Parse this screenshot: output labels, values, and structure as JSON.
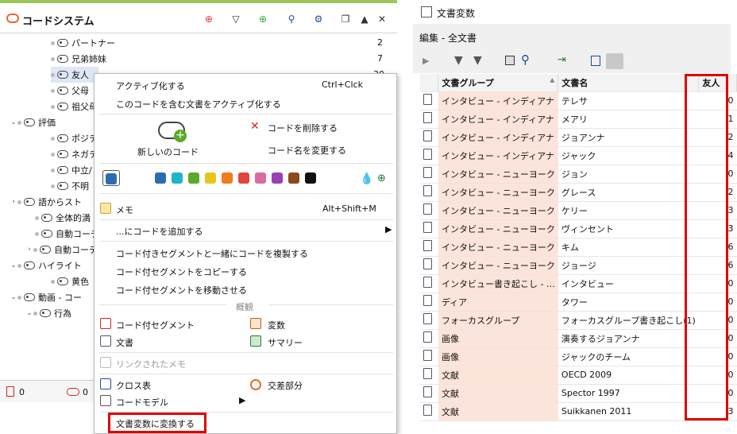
{
  "colors": {
    "accent": "#9bc65a",
    "highlight": "#e00000",
    "groupcell": "#fde4da"
  },
  "left": {
    "title": "コードシステム",
    "header_icons": [
      "code-system-icon",
      "filter-icon",
      "new-code-icon",
      "search-icon",
      "gear-icon",
      "undock-icon",
      "collapse-icon",
      "close-icon"
    ],
    "tree": [
      {
        "label": "パートナー",
        "count": "2"
      },
      {
        "label": "兄弟姉妹",
        "count": "7"
      },
      {
        "label": "友人",
        "count": "30"
      },
      {
        "label": "父母",
        "count": ""
      },
      {
        "label": "祖父母",
        "count": ""
      },
      {
        "label": "評価",
        "count": ""
      },
      {
        "label": "ポジテ",
        "count": ""
      },
      {
        "label": "ネガテ",
        "count": ""
      },
      {
        "label": "中立/",
        "count": ""
      },
      {
        "label": "不明",
        "count": ""
      },
      {
        "label": "語からスト",
        "count": ""
      },
      {
        "label": "全体的満",
        "count": ""
      },
      {
        "label": "自動コーデ",
        "count": ""
      },
      {
        "label": "自動コーデ",
        "count": ""
      },
      {
        "label": "ハイライト",
        "count": ""
      },
      {
        "label": "黄色",
        "count": ""
      },
      {
        "label": "動画 - コー",
        "count": ""
      },
      {
        "label": "行為",
        "count": ""
      }
    ],
    "footer": {
      "a": "0",
      "b": "0"
    }
  },
  "menu": {
    "activate": "アクティブ化する",
    "activate_shortcut": "Ctrl+Clck",
    "activate_docs": "このコードを含む文書をアクティブ化する",
    "new_code": "新しいのコード",
    "delete_code": "コードを削除する",
    "rename_code": "コード名を変更する",
    "memo": "メモ",
    "memo_shortcut": "Alt+Shift+M",
    "add_code": "...にコードを追加する",
    "duplicate": "コード付きセグメントと一緒にコードを複製する",
    "copy_segments": "コード付セグメントをコピーする",
    "move_segments": "コード付セグメントを移動させる",
    "overview": "概観",
    "coded_segments": "コード付セグメント",
    "variables": "変数",
    "documents": "文書",
    "summary": "サマリー",
    "linked_memo": "リンクされたメモ",
    "crosstab": "クロス表",
    "intersection": "交差部分",
    "code_model": "コードモデル",
    "convert": "文書変数に変換する",
    "swatches": [
      "#2b6cb0",
      "#1fb5c6",
      "#5aaa2a",
      "#e8c619",
      "#ef7d1a",
      "#e0463a",
      "#d96aa4",
      "#9a3fb4",
      "#8b4a1c",
      "#111111"
    ]
  },
  "right": {
    "title": "文書変数",
    "subtitle": "編集 - 全文書",
    "columns": {
      "group": "文書グループ",
      "name": "文書名",
      "friend": "友人"
    },
    "rows": [
      {
        "group": "インタビュー - インディアナ",
        "name": "テレサ",
        "v": "0"
      },
      {
        "group": "インタビュー - インディアナ",
        "name": "メアリ",
        "v": "1"
      },
      {
        "group": "インタビュー - インディアナ",
        "name": "ジョアンナ",
        "v": "2"
      },
      {
        "group": "インタビュー - インディアナ",
        "name": "ジャック",
        "v": "4"
      },
      {
        "group": "インタビュー - ニューヨーク",
        "name": "ジョン",
        "v": "0"
      },
      {
        "group": "インタビュー - ニューヨーク",
        "name": "グレース",
        "v": "2"
      },
      {
        "group": "インタビュー - ニューヨーク",
        "name": "ケリー",
        "v": "3"
      },
      {
        "group": "インタビュー - ニューヨーク",
        "name": "ヴィンセント",
        "v": "3"
      },
      {
        "group": "インタビュー - ニューヨーク",
        "name": "キム",
        "v": "6"
      },
      {
        "group": "インタビュー - ニューヨーク",
        "name": "ジョージ",
        "v": "6"
      },
      {
        "group": "インタビュー書き起こし - …",
        "name": "インタビュー",
        "v": "0"
      },
      {
        "group": "ディア",
        "name": "タワー",
        "v": "0"
      },
      {
        "group": "フォーカスグループ",
        "name": "フォーカスグループ書き起こし(1)",
        "v": "0"
      },
      {
        "group": "画像",
        "name": "演奏するジョアンナ",
        "v": "0"
      },
      {
        "group": "画像",
        "name": "ジャックのチーム",
        "v": "0"
      },
      {
        "group": "文献",
        "name": "OECD 2009",
        "v": "0"
      },
      {
        "group": "文献",
        "name": "Spector 1997",
        "v": "0"
      },
      {
        "group": "文献",
        "name": "Suikkanen 2011",
        "v": "3"
      }
    ]
  }
}
